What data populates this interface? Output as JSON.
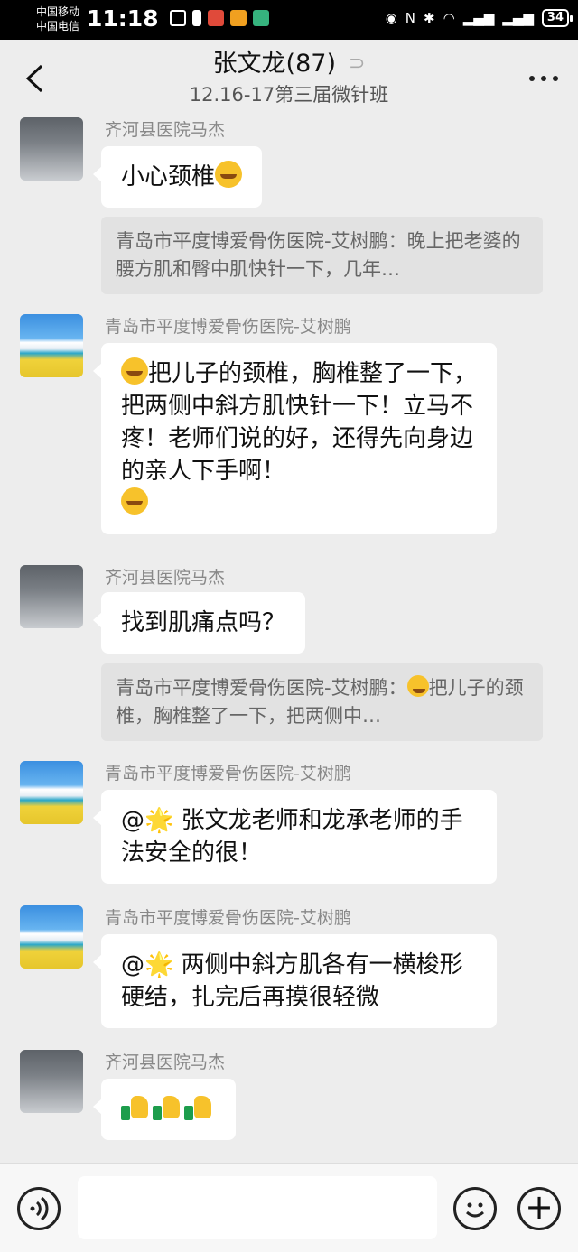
{
  "status_bar": {
    "carrier_1": "中国移动",
    "carrier_2": "中国电信",
    "time": "11:18",
    "battery": "34"
  },
  "header": {
    "title": "张文龙(87)",
    "subtitle": "12.16-17第三届微针班"
  },
  "messages": [
    {
      "sender": "齐河县医院马杰",
      "text": "小心颈椎"
    },
    {
      "quote": "青岛市平度博爱骨伤医院-艾树鹏：晚上把老婆的腰方肌和臀中肌快针一下，几年…"
    },
    {
      "sender": "青岛市平度博爱骨伤医院-艾树鹏",
      "text": "把儿子的颈椎，胸椎整了一下，把两侧中斜方肌快针一下！立马不疼！老师们说的好，还得先向身边的亲人下手啊！"
    },
    {
      "sender": "齐河县医院马杰",
      "text": "找到肌痛点吗？"
    },
    {
      "quote_prefix": "青岛市平度博爱骨伤医院-艾树鹏：",
      "quote_suffix": "把儿子的颈椎，胸椎整了一下，把两侧中…"
    },
    {
      "sender": "青岛市平度博爱骨伤医院-艾树鹏",
      "text": "张文龙老师和龙承老师的手法安全的很！"
    },
    {
      "sender": "青岛市平度博爱骨伤医院-艾树鹏",
      "text": "两侧中斜方肌各有一横梭形硬结，扎完后再摸很轻微"
    },
    {
      "sender": "齐河县医院马杰",
      "text": ""
    }
  ],
  "mention_prefix": "@",
  "star_glyph": "🌟",
  "plus_glyph": "+",
  "colors": {
    "accent_green": "#1d9d4c",
    "emoji_yellow": "#f7c22b"
  }
}
